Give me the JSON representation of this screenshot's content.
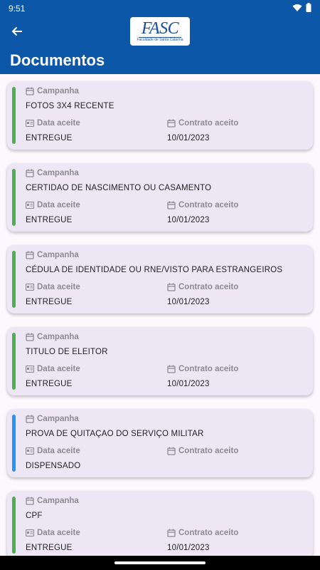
{
  "status_bar": {
    "time": "9:51"
  },
  "header": {
    "logo_text": "FASC",
    "logo_subtitle": "Faculdade de Santa Catarina",
    "title": "Documentos"
  },
  "labels": {
    "campaign": "Campanha",
    "accepted_date": "Data aceite",
    "contract_accepted": "Contrato aceito"
  },
  "colors": {
    "primary": "#0d57a8",
    "delivered": "#4caf50",
    "waived": "#2196f3"
  },
  "documents": [
    {
      "name": "FOTOS 3X4 RECENTE",
      "status": "ENTREGUE",
      "date": "10/01/2023"
    },
    {
      "name": "CERTIDAO DE NASCIMENTO OU CASAMENTO",
      "status": "ENTREGUE",
      "date": "10/01/2023"
    },
    {
      "name": "CÉDULA DE IDENTIDADE OU RNE/VISTO PARA ESTRANGEIROS",
      "status": "ENTREGUE",
      "date": "10/01/2023"
    },
    {
      "name": "TITULO DE ELEITOR",
      "status": "ENTREGUE",
      "date": "10/01/2023"
    },
    {
      "name": "PROVA DE QUITAÇAO DO SERVIÇO MILITAR",
      "status": "DISPENSADO",
      "date": ""
    },
    {
      "name": "CPF",
      "status": "ENTREGUE",
      "date": "10/01/2023"
    }
  ]
}
